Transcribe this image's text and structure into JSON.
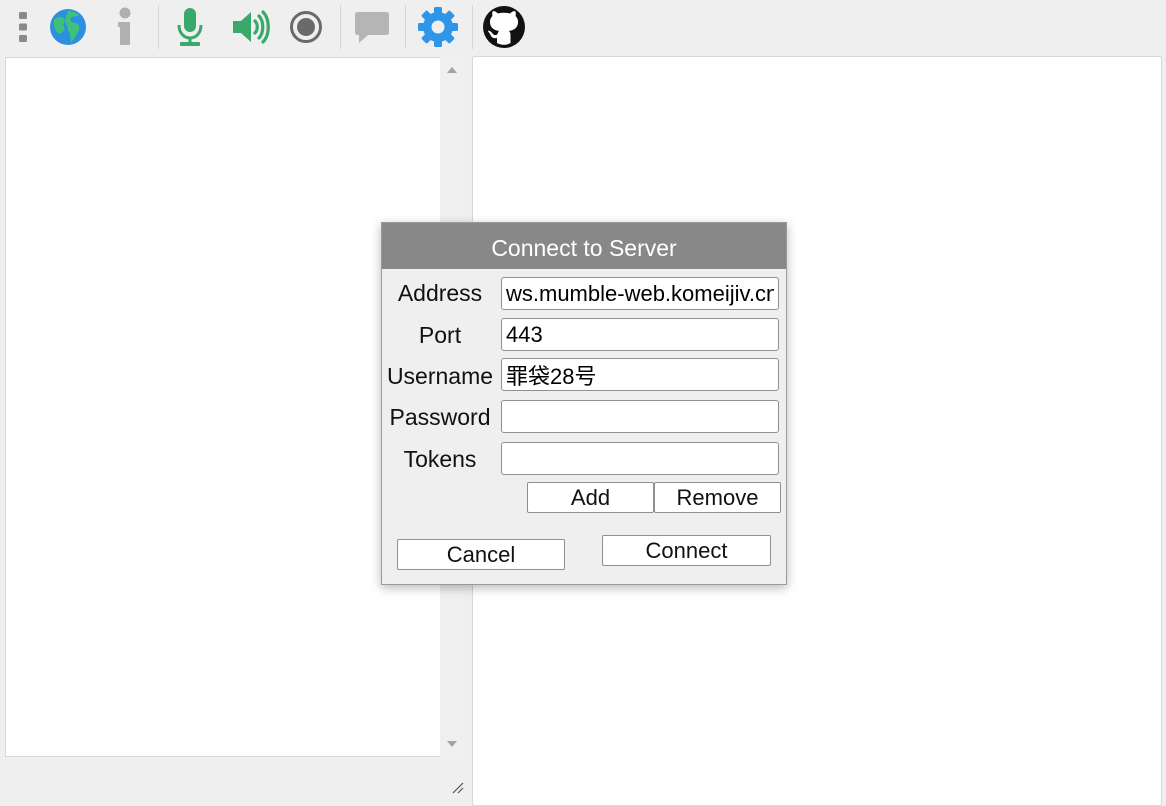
{
  "toolbar": {
    "items": [
      {
        "name": "menu",
        "icon": "more-vertical-icon",
        "color": "#8a8a8a"
      },
      {
        "name": "connect",
        "icon": "globe-icon",
        "color": "#2d8fe0"
      },
      {
        "name": "info",
        "icon": "info-icon",
        "color": "#b0b0b0"
      },
      {
        "name": "microphone",
        "icon": "microphone-icon",
        "color": "#3aa86b"
      },
      {
        "name": "speaker",
        "icon": "speaker-icon",
        "color": "#3aa86b"
      },
      {
        "name": "record",
        "icon": "record-icon",
        "color": "#6a6a6a"
      },
      {
        "name": "chat",
        "icon": "chat-bubble-icon",
        "color": "#b5b5b5"
      },
      {
        "name": "settings",
        "icon": "gear-icon",
        "color": "#2e95e8"
      },
      {
        "name": "github",
        "icon": "github-icon",
        "color": "#111111"
      }
    ]
  },
  "dialog": {
    "title": "Connect to Server",
    "fields": {
      "address": {
        "label": "Address",
        "value": "ws.mumble-web.komeijiv.cn"
      },
      "port": {
        "label": "Port",
        "value": "443"
      },
      "username": {
        "label": "Username",
        "value": "罪袋28号"
      },
      "password": {
        "label": "Password",
        "value": ""
      },
      "tokens": {
        "label": "Tokens",
        "value": ""
      }
    },
    "buttons": {
      "add": "Add",
      "remove": "Remove",
      "cancel": "Cancel",
      "connect": "Connect"
    }
  }
}
